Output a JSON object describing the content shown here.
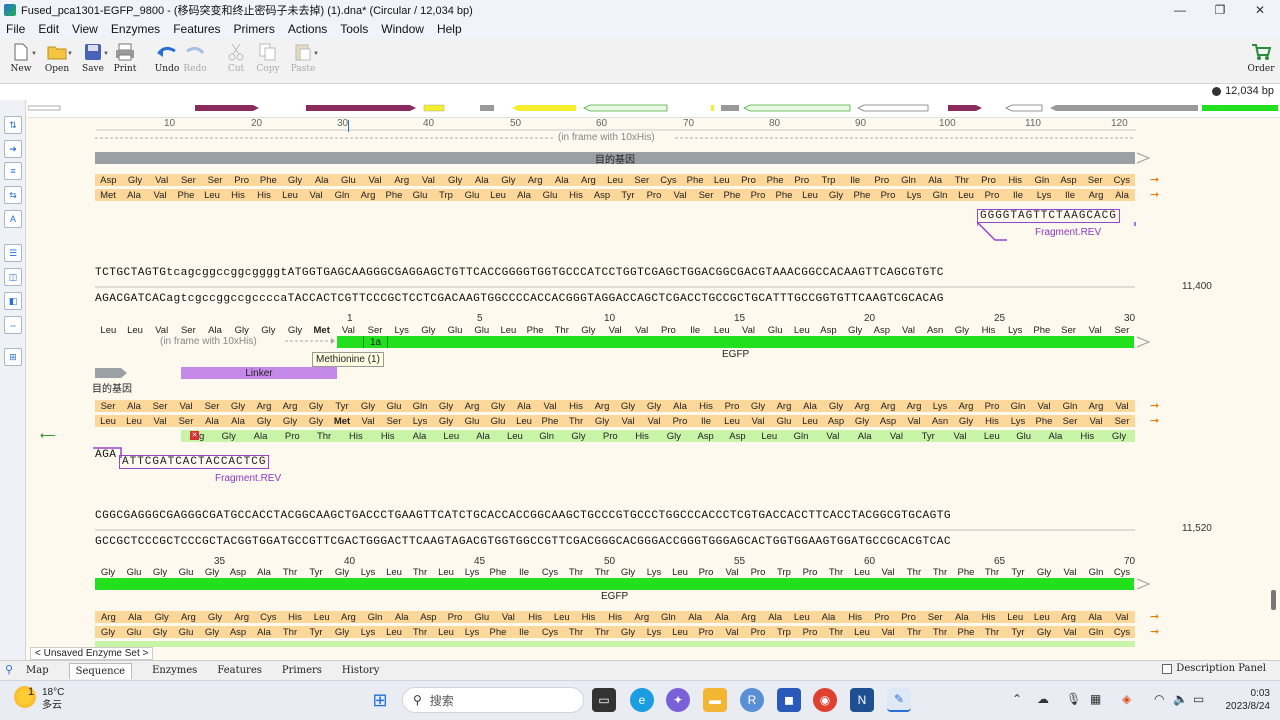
{
  "window": {
    "title": "Fused_pca1301-EGFP_9800 - (移码突变和终止密码子未去掉) (1).dna*  (Circular / 12,034 bp)",
    "controls": [
      "—",
      "❐",
      "✕"
    ]
  },
  "menu": [
    "File",
    "Edit",
    "View",
    "Enzymes",
    "Features",
    "Primers",
    "Actions",
    "Tools",
    "Window",
    "Help"
  ],
  "toolbar": {
    "new": "New",
    "open": "Open",
    "save": "Save",
    "print": "Print",
    "undo": "Undo",
    "redo": "Redo",
    "cut": "Cut",
    "copy": "Copy",
    "paste": "Paste",
    "order": "Order"
  },
  "size_info": "12,034 bp",
  "ruler_ticks": [
    "10",
    "20",
    "30",
    "40",
    "50",
    "60",
    "70",
    "80",
    "90",
    "100",
    "110",
    "120"
  ],
  "block1": {
    "frame_note": "(in frame with 10xHis)",
    "feature_label": "目的基因",
    "aa_orange": [
      "Asp",
      "Gly",
      "Val",
      "Ser",
      "Ser",
      "Pro",
      "Phe",
      "Gly",
      "Ala",
      "Glu",
      "Val",
      "Arg",
      "Val",
      "Gly",
      "Ala",
      "Gly",
      "Arg",
      "Ala",
      "Arg",
      "Leu",
      "Ser",
      "Cys",
      "Phe",
      "Leu",
      "Pro",
      "Phe",
      "Pro",
      "Trp",
      "Ile",
      "Pro",
      "Gln",
      "Ala",
      "Thr",
      "Pro",
      "His",
      "Gln",
      "Asp",
      "Ser",
      "Cys"
    ],
    "aa_orange2": [
      "Met",
      "Ala",
      "Val",
      "Phe",
      "Leu",
      "His",
      "His",
      "Leu",
      "Val",
      "Gln",
      "Arg",
      "Phe",
      "Glu",
      "Trp",
      "Glu",
      "Leu",
      "Ala",
      "Glu",
      "His",
      "Asp",
      "Tyr",
      "Pro",
      "Val",
      "Ser",
      "Phe",
      "Pro",
      "Phe",
      "Leu",
      "Gly",
      "Phe",
      "Pro",
      "Lys",
      "Gln",
      "Leu",
      "Pro",
      "Ile",
      "Lys",
      "Ile",
      "Arg",
      "Ala"
    ],
    "primer_seq": "GGGGTAGTTCTAAGCACG",
    "primer_label": "Fragment.REV",
    "top_strand": "TCTGCTAGTGtcagcggccggcggggtATGGTGAGCAAGGGCGAGGAGCTGTTCACCGGGGTGGTGCCCATCCTGGTCGAGCTGGACGGCGACGTAAACGGCCACAAGTTCAGCGTGTC",
    "bottom_strand": "AGACGATCACagtcgccggccgccccaTACCACTCGTTCCCGCTCCTCGACAAGTGGCCCCACCACGGGTAGGACCAGCTCGACCTGCCGCTGCATTTGCCGGTGTTCAAGTCGCACAG",
    "coord": "11,400",
    "aa_numbers": [
      "1",
      "5",
      "10",
      "15",
      "20",
      "25",
      "30"
    ],
    "aa_egfp": [
      "Leu",
      "Leu",
      "Val",
      "Ser",
      "Ala",
      "Gly",
      "Gly",
      "Gly",
      "Met",
      "Val",
      "Ser",
      "Lys",
      "Gly",
      "Glu",
      "Glu",
      "Leu",
      "Phe",
      "Thr",
      "Gly",
      "Val",
      "Val",
      "Pro",
      "Ile",
      "Leu",
      "Val",
      "Glu",
      "Leu",
      "Asp",
      "Gly",
      "Asp",
      "Val",
      "Asn",
      "Gly",
      "His",
      "Lys",
      "Phe",
      "Ser",
      "Val",
      "Ser"
    ],
    "frame_note2": "(in frame with 10xHis)",
    "egfp_label": "EGFP",
    "segment_1a": "1a",
    "tooltip": "Methionine (1)",
    "linker_label": "Linker",
    "feature_label2": "目的基因",
    "aa_row_a": [
      "Ser",
      "Ala",
      "Ser",
      "Val",
      "Ser",
      "Gly",
      "Arg",
      "Arg",
      "Gly",
      "Tyr",
      "Gly",
      "Glu",
      "Gln",
      "Gly",
      "Arg",
      "Gly",
      "Ala",
      "Val",
      "His",
      "Arg",
      "Gly",
      "Gly",
      "Ala",
      "His",
      "Pro",
      "Gly",
      "Arg",
      "Ala",
      "Gly",
      "Arg",
      "Arg",
      "Arg",
      "Lys",
      "Arg",
      "Pro",
      "Gln",
      "Val",
      "Gln",
      "Arg",
      "Val"
    ],
    "aa_row_b": [
      "Leu",
      "Leu",
      "Val",
      "Ser",
      "Ala",
      "Ala",
      "Gly",
      "Gly",
      "Gly",
      "Met",
      "Val",
      "Ser",
      "Lys",
      "Gly",
      "Glu",
      "Glu",
      "Leu",
      "Phe",
      "Thr",
      "Gly",
      "Val",
      "Val",
      "Pro",
      "Ile",
      "Leu",
      "Val",
      "Glu",
      "Leu",
      "Asp",
      "Gly",
      "Asp",
      "Val",
      "Asn",
      "Gly",
      "His",
      "Lys",
      "Phe",
      "Ser",
      "Val",
      "Ser"
    ],
    "aa_row_c": [
      "Arg",
      "Gly",
      "Ala",
      "Pro",
      "Thr",
      "His",
      "His",
      "Ala",
      "Leu",
      "Ala",
      "Leu",
      "Gln",
      "Gly",
      "Pro",
      "His",
      "Gly",
      "Asp",
      "Asp",
      "Leu",
      "Gln",
      "Val",
      "Ala",
      "Val",
      "Tyr",
      "Val",
      "Leu",
      "Glu",
      "Ala",
      "His",
      "Gly"
    ],
    "primer2_prefix": "AGA",
    "primer2_seq": "ATTCGATCACTACCACTCG",
    "primer2_label": "Fragment.REV"
  },
  "block2": {
    "top_strand": "CGGCGAGGGCGAGGGCGATGCCACCTACGGCAAGCTGACCCTGAAGTTCATCTGCACCACCGGCAAGCTGCCCGTGCCCTGGCCCACCCTCGTGACCACCTTCACCTACGGCGTGCAGTG",
    "bottom_strand": "GCCGCTCCCGCTCCCGCTACGGTGGATGCCGTTCGACTGGGACTTCAAGTAGACGTGGTGGCCGTTCGACGGGCACGGGACCGGGTGGGAGCACTGGTGGAAGTGGATGCCGCACGTCAC",
    "coord": "11,520",
    "aa_numbers": [
      "35",
      "40",
      "45",
      "50",
      "55",
      "60",
      "65",
      "70"
    ],
    "aa_egfp": [
      "Gly",
      "Glu",
      "Gly",
      "Glu",
      "Gly",
      "Asp",
      "Ala",
      "Thr",
      "Tyr",
      "Gly",
      "Lys",
      "Leu",
      "Thr",
      "Leu",
      "Lys",
      "Phe",
      "Ile",
      "Cys",
      "Thr",
      "Thr",
      "Gly",
      "Lys",
      "Leu",
      "Pro",
      "Val",
      "Pro",
      "Trp",
      "Pro",
      "Thr",
      "Leu",
      "Val",
      "Thr",
      "Thr",
      "Phe",
      "Thr",
      "Tyr",
      "Gly",
      "Val",
      "Gln",
      "Cys"
    ],
    "egfp_label": "EGFP",
    "aa_row_a": [
      "Arg",
      "Ala",
      "Gly",
      "Arg",
      "Gly",
      "Arg",
      "Cys",
      "His",
      "Leu",
      "Arg",
      "Gln",
      "Ala",
      "Asp",
      "Pro",
      "Glu",
      "Val",
      "His",
      "Leu",
      "His",
      "His",
      "Arg",
      "Gln",
      "Ala",
      "Ala",
      "Arg",
      "Ala",
      "Leu",
      "Ala",
      "His",
      "Pro",
      "Pro",
      "Ser",
      "Ala",
      "His",
      "Leu",
      "Leu",
      "Arg",
      "Ala",
      "Val"
    ],
    "aa_row_b": [
      "Gly",
      "Glu",
      "Gly",
      "Glu",
      "Gly",
      "Asp",
      "Ala",
      "Thr",
      "Tyr",
      "Gly",
      "Lys",
      "Leu",
      "Thr",
      "Leu",
      "Lys",
      "Phe",
      "Ile",
      "Cys",
      "Thr",
      "Thr",
      "Gly",
      "Lys",
      "Leu",
      "Pro",
      "Val",
      "Pro",
      "Trp",
      "Pro",
      "Thr",
      "Leu",
      "Val",
      "Thr",
      "Thr",
      "Phe",
      "Thr",
      "Tyr",
      "Gly",
      "Val",
      "Gln",
      "Cys"
    ]
  },
  "enzyme_set": "< Unsaved Enzyme Set >",
  "bottom_tabs": [
    "Map",
    "Sequence",
    "Enzymes",
    "Features",
    "Primers",
    "History"
  ],
  "description_panel": "Description Panel",
  "taskbar": {
    "temperature": "18°C",
    "weather": "多云",
    "badge": "1",
    "search": "搜索",
    "time": "0:03",
    "date": "2023/8/24"
  },
  "colors": {
    "egfp": "#22e01e",
    "linker": "#c58ae8",
    "gene_gray": "#9aa0a6",
    "aa_orange": "#fcd79a",
    "aa_green": "#c8f4a8",
    "primer": "#9a45c8"
  }
}
